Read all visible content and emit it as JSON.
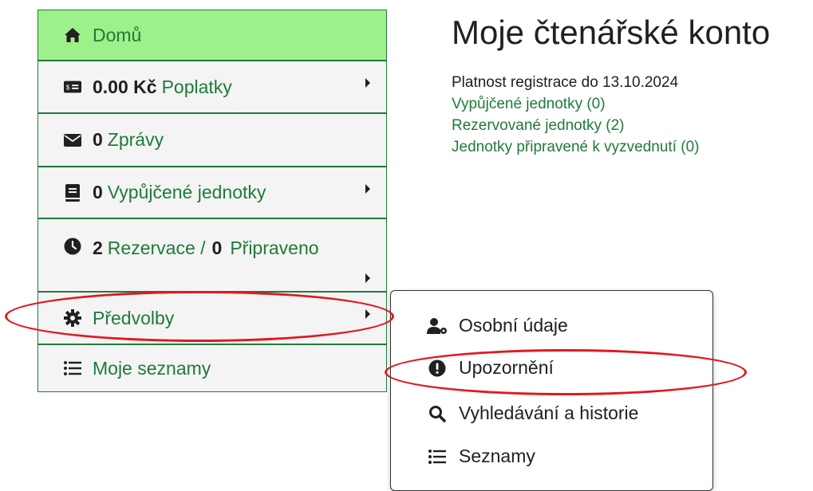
{
  "sidebar": {
    "home": "Domů",
    "fees_amount": "0.00 Kč",
    "fees_label": "Poplatky",
    "messages_count": "0",
    "messages_label": "Zprávy",
    "loans_count": "0",
    "loans_label": "Vypůjčené jednotky",
    "holds_count": "2",
    "holds_label": "Rezervace /",
    "ready_count": "0",
    "ready_label": "Připraveno",
    "preferences": "Předvolby",
    "lists": "Moje seznamy"
  },
  "main": {
    "title": "Moje čtenářské konto",
    "registration": "Platnost registrace do 13.10.2024",
    "links": [
      "Vypůjčené jednotky (0)",
      "Rezervované jednotky (2)",
      "Jednotky připravené k vyzvednutí (0)"
    ]
  },
  "dropdown": {
    "personal": "Osobní údaje",
    "notifications": "Upozornění",
    "search_history": "Vyhledávání a historie",
    "lists": "Seznamy"
  },
  "colors": {
    "accent": "#1f7a3a",
    "home_bg": "#9ef08a",
    "highlight": "#e0191f"
  }
}
